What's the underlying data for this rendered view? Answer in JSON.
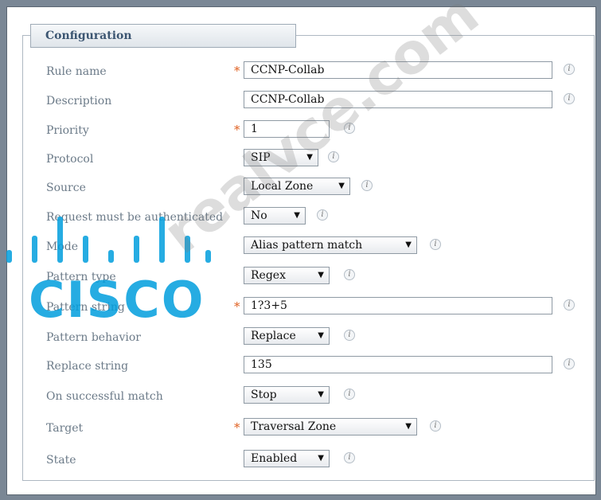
{
  "panel": {
    "title": "Configuration"
  },
  "fields": [
    {
      "label": "Rule name",
      "required": true,
      "type": "text",
      "value": "CCNP-Collab"
    },
    {
      "label": "Description",
      "required": false,
      "type": "text",
      "value": "CCNP-Collab"
    },
    {
      "label": "Priority",
      "required": true,
      "type": "text",
      "value": "1"
    },
    {
      "label": "Protocol",
      "required": false,
      "type": "select",
      "value": "SIP"
    },
    {
      "label": "Source",
      "required": false,
      "type": "select",
      "value": "Local Zone"
    },
    {
      "label": "Request must be authenticated",
      "required": false,
      "type": "select",
      "value": "No"
    },
    {
      "label": "Mode",
      "required": false,
      "type": "select",
      "value": "Alias pattern match"
    },
    {
      "label": "Pattern type",
      "required": false,
      "type": "select",
      "value": "Regex"
    },
    {
      "label": "Pattern string",
      "required": true,
      "type": "text",
      "value": "1?3+5"
    },
    {
      "label": "Pattern behavior",
      "required": false,
      "type": "select",
      "value": "Replace"
    },
    {
      "label": "Replace string",
      "required": false,
      "type": "text",
      "value": "135"
    },
    {
      "label": "On successful match",
      "required": false,
      "type": "select",
      "value": "Stop"
    },
    {
      "label": "Target",
      "required": true,
      "type": "select",
      "value": "Traversal Zone"
    },
    {
      "label": "State",
      "required": false,
      "type": "select",
      "value": "Enabled"
    }
  ],
  "symbols": {
    "required_marker": "*",
    "info_icon": "i",
    "dropdown_caret": "▼"
  },
  "watermark": {
    "logo_text": "CISCO",
    "site_text": "realvce.com"
  },
  "colors": {
    "required": "#e06020",
    "label": "#6b7a88",
    "header_text": "#3c5672",
    "watermark_logo": "#009edd"
  }
}
